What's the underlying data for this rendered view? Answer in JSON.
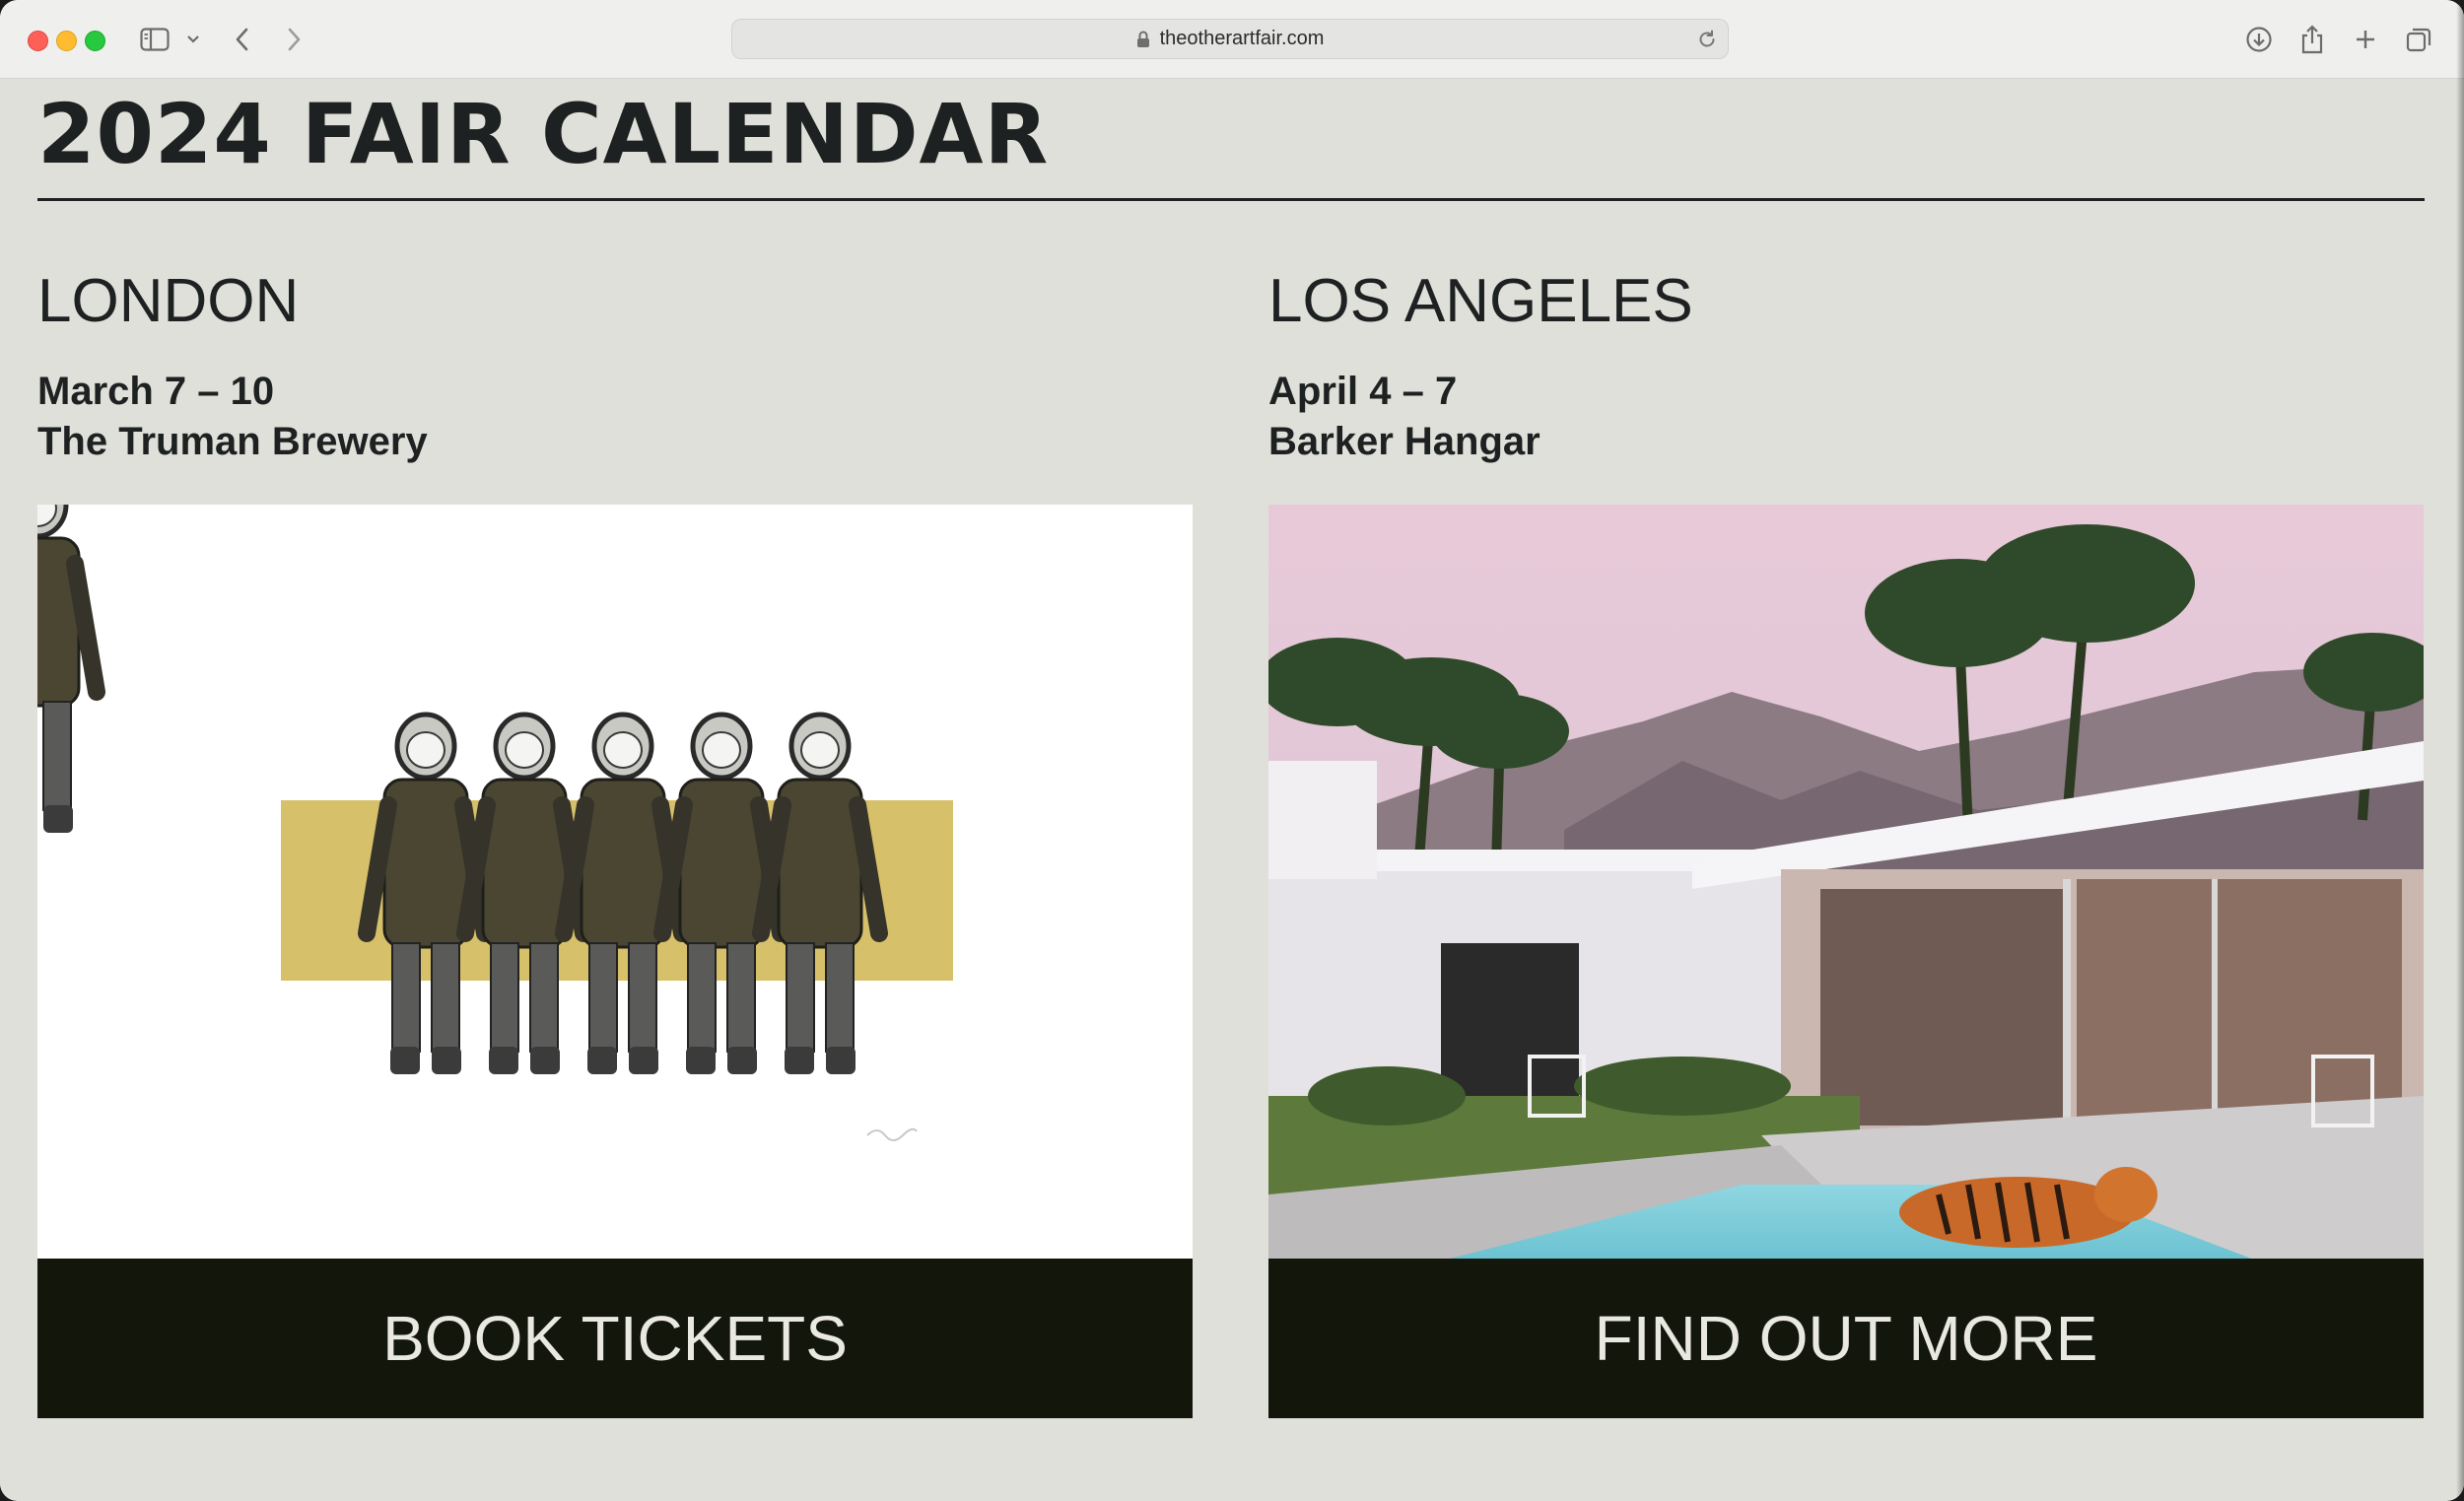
{
  "browser": {
    "url": "theotherartfair.com",
    "icons": {
      "close": "close-dot",
      "minimize": "minimize-dot",
      "maximize": "maximize-dot",
      "sidebar": "sidebar-icon",
      "sidebar_menu": "chevron-down-icon",
      "back": "chevron-left-icon",
      "forward": "chevron-right-icon",
      "secure": "lock-icon",
      "reload": "reload-icon",
      "downloads": "download-icon",
      "share": "share-icon",
      "new_tab": "plus-icon",
      "tab_overview": "tabs-icon"
    }
  },
  "page": {
    "title": "2024 FAIR CALENDAR",
    "fairs": [
      {
        "city": "LONDON",
        "dates": "March 7 – 10",
        "venue": "The Truman Brewery",
        "artwork": "astronauts-artwork",
        "cta_label": "BOOK TICKETS"
      },
      {
        "city": "LOS ANGELES",
        "dates": "April 4 – 7",
        "venue": "Barker Hangar",
        "artwork": "modernist-house-tiger-artwork",
        "cta_label": "FIND OUT MORE"
      }
    ]
  },
  "colors": {
    "page_background": "#e0e0da",
    "text": "#1e2121",
    "button_background": "#13170b",
    "button_text": "#e9e9e2",
    "artwork_ochre": "#d7c06a"
  }
}
